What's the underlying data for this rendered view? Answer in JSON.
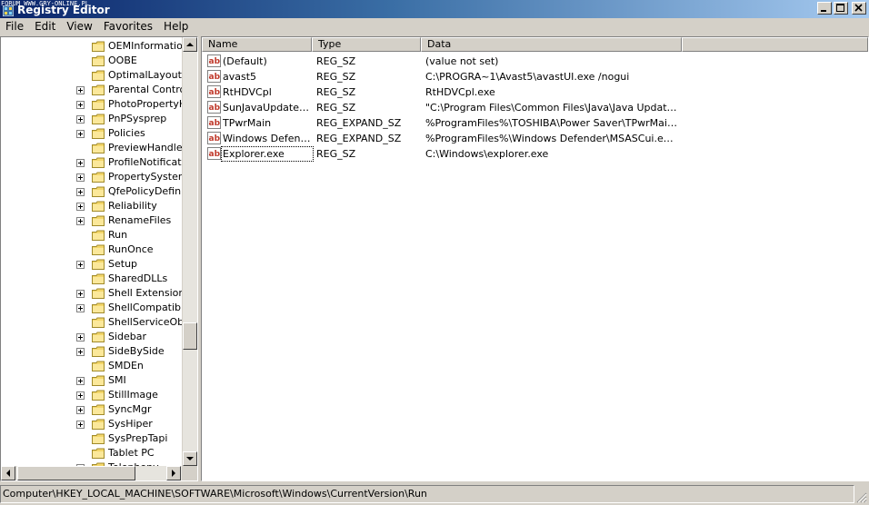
{
  "watermark": "FORUM WWW.GRY-ONLINE.PL",
  "window": {
    "title": "Registry Editor"
  },
  "menu": [
    "File",
    "Edit",
    "View",
    "Favorites",
    "Help"
  ],
  "tree": {
    "items": [
      {
        "label": "OEMInformation",
        "expandable": false
      },
      {
        "label": "OOBE",
        "expandable": false
      },
      {
        "label": "OptimalLayout",
        "expandable": false
      },
      {
        "label": "Parental Controls",
        "expandable": true
      },
      {
        "label": "PhotoPropertyHandler",
        "expandable": true
      },
      {
        "label": "PnPSysprep",
        "expandable": true
      },
      {
        "label": "Policies",
        "expandable": true
      },
      {
        "label": "PreviewHandlers",
        "expandable": false
      },
      {
        "label": "ProfileNotification",
        "expandable": true
      },
      {
        "label": "PropertySystem",
        "expandable": true
      },
      {
        "label": "QfePolicyDefinitions",
        "expandable": true
      },
      {
        "label": "Reliability",
        "expandable": true
      },
      {
        "label": "RenameFiles",
        "expandable": true
      },
      {
        "label": "Run",
        "expandable": false
      },
      {
        "label": "RunOnce",
        "expandable": false
      },
      {
        "label": "Setup",
        "expandable": true
      },
      {
        "label": "SharedDLLs",
        "expandable": false
      },
      {
        "label": "Shell Extensions",
        "expandable": true
      },
      {
        "label": "ShellCompatibility",
        "expandable": true
      },
      {
        "label": "ShellServiceObjects",
        "expandable": false
      },
      {
        "label": "Sidebar",
        "expandable": true
      },
      {
        "label": "SideBySide",
        "expandable": true
      },
      {
        "label": "SMDEn",
        "expandable": false
      },
      {
        "label": "SMI",
        "expandable": true
      },
      {
        "label": "StillImage",
        "expandable": true
      },
      {
        "label": "SyncMgr",
        "expandable": true
      },
      {
        "label": "SysHiper",
        "expandable": true
      },
      {
        "label": "SysPrepTapi",
        "expandable": false
      },
      {
        "label": "Tablet PC",
        "expandable": false
      },
      {
        "label": "Telephony",
        "expandable": true
      }
    ]
  },
  "list": {
    "columns": [
      "Name",
      "Type",
      "Data"
    ],
    "rows": [
      {
        "name": "(Default)",
        "type": "REG_SZ",
        "data": "(value not set)"
      },
      {
        "name": "avast5",
        "type": "REG_SZ",
        "data": "C:\\PROGRA~1\\Avast5\\avastUI.exe /nogui"
      },
      {
        "name": "RtHDVCpl",
        "type": "REG_SZ",
        "data": "RtHDVCpl.exe"
      },
      {
        "name": "SunJavaUpdateSched",
        "type": "REG_SZ",
        "data": "\"C:\\Program Files\\Common Files\\Java\\Java Update\\jusched.exe\""
      },
      {
        "name": "TPwrMain",
        "type": "REG_EXPAND_SZ",
        "data": "%ProgramFiles%\\TOSHIBA\\Power Saver\\TPwrMain.EXE"
      },
      {
        "name": "Windows Defender",
        "type": "REG_EXPAND_SZ",
        "data": "%ProgramFiles%\\Windows Defender\\MSASCui.exe -hide"
      },
      {
        "name": "Explorer.exe",
        "type": "REG_SZ",
        "data": "C:\\Windows\\explorer.exe"
      }
    ]
  },
  "status": {
    "path": "Computer\\HKEY_LOCAL_MACHINE\\SOFTWARE\\Microsoft\\Windows\\CurrentVersion\\Run"
  },
  "colors": {
    "titlebar_start": "#0a246a",
    "titlebar_end": "#a6caf0",
    "chrome": "#d4d0c8",
    "folder": "#f4d76a",
    "value_icon": "#c0392b"
  }
}
